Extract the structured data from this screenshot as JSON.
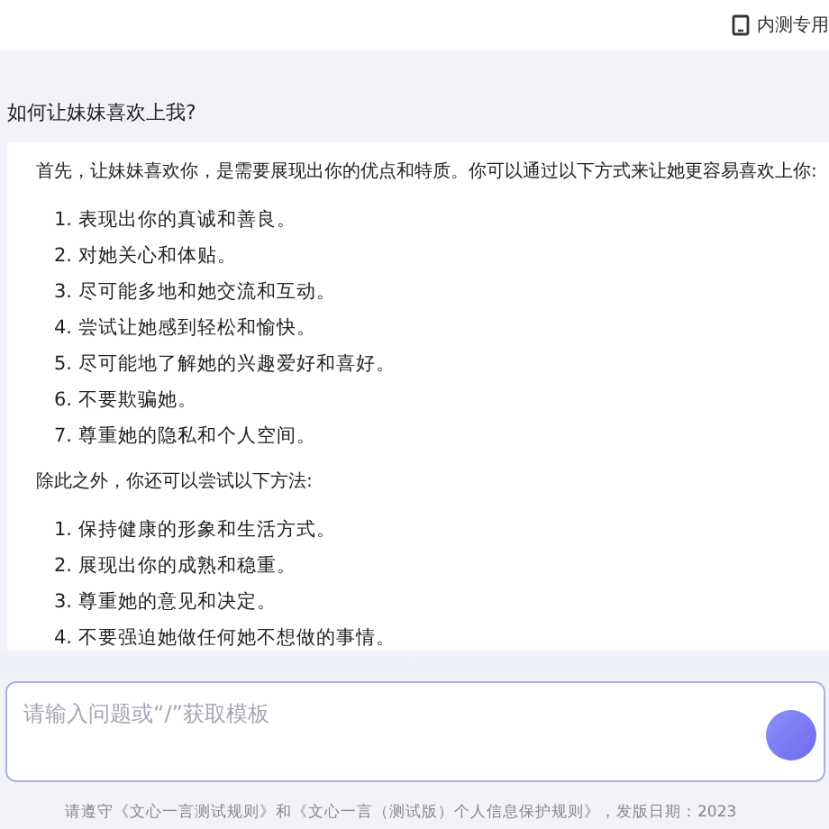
{
  "header": {
    "badge": "内测专用"
  },
  "question": "如何让妹妹喜欢上我?",
  "answer": [
    {
      "kind": "paragraph",
      "text": "首先，让妹妹喜欢你，是需要展现出你的优点和特质。你可以通过以下方式来让她更容易喜欢上你:"
    },
    {
      "kind": "list",
      "items": [
        "1. 表现出你的真诚和善良。",
        "2. 对她关心和体贴。",
        "3. 尽可能多地和她交流和互动。",
        "4. 尝试让她感到轻松和愉快。",
        "5. 尽可能地了解她的兴趣爱好和喜好。",
        "6. 不要欺骗她。",
        "7. 尊重她的隐私和个人空间。"
      ]
    },
    {
      "kind": "paragraph",
      "text": "除此之外，你还可以尝试以下方法:"
    },
    {
      "kind": "list",
      "items": [
        "1. 保持健康的形象和生活方式。",
        "2. 展现出你的成熟和稳重。",
        "3. 尊重她的意见和决定。",
        "4. 不要强迫她做任何她不想做的事情。"
      ]
    }
  ],
  "input": {
    "placeholder": "请输入问题或“/”获取模板"
  },
  "footer": "请遵守《文心一言测试规则》和《文心一言（测试版）个人信息保护规则》，发版日期：2023"
}
